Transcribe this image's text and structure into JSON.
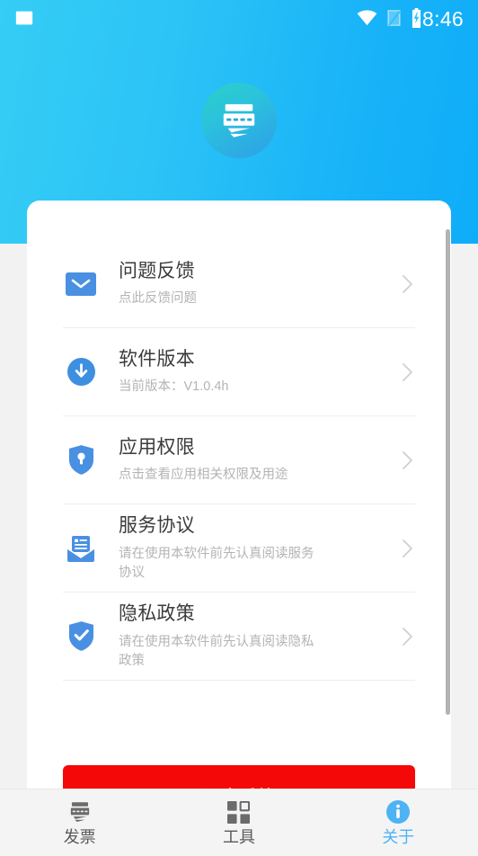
{
  "status_bar": {
    "time": "8:46",
    "left_icons": [
      "image-icon"
    ],
    "right_icons": [
      "wifi-icon",
      "signal-icon",
      "battery-charging-icon"
    ]
  },
  "header": {
    "logo_icon": "invoice-card-logo",
    "gradient_from": "#35cdf5",
    "gradient_to": "#0fadf9"
  },
  "list": {
    "items": [
      {
        "icon": "envelope-icon",
        "title": "问题反馈",
        "subtitle": "点此反馈问题"
      },
      {
        "icon": "download-circle-icon",
        "title": "软件版本",
        "subtitle": "当前版本：V1.0.4h"
      },
      {
        "icon": "shield-key-icon",
        "title": "应用权限",
        "subtitle": "点击查看应用相关权限及用途"
      },
      {
        "icon": "document-envelope-icon",
        "title": "服务协议",
        "subtitle": "请在使用本软件前先认真阅读服务协议"
      },
      {
        "icon": "shield-check-icon",
        "title": "隐私政策",
        "subtitle": "请在使用本软件前先认真阅读隐私政策"
      }
    ],
    "chevron": "chevron-right-icon"
  },
  "exit_button": {
    "label": "退出系统",
    "color": "#f50808"
  },
  "bottom_nav": {
    "active_color": "#4db3f5",
    "items": [
      {
        "icon": "invoice-icon",
        "label": "发票",
        "active": false
      },
      {
        "icon": "grid-tools-icon",
        "label": "工具",
        "active": false
      },
      {
        "icon": "info-circle-icon",
        "label": "关于",
        "active": true
      }
    ]
  }
}
